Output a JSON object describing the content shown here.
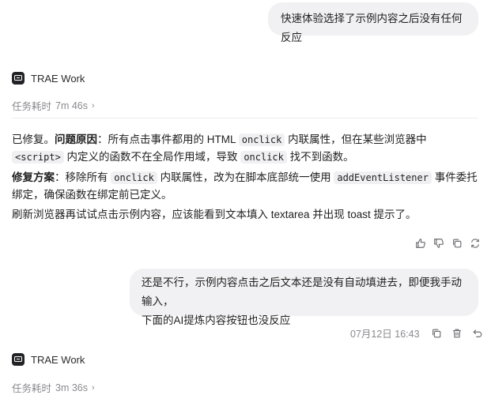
{
  "messages": {
    "user_1": "快速体验选择了示例内容之后没有任何反应",
    "agent_1": {
      "name": "TRAE Work",
      "task_time_label": "任务耗时",
      "task_time_value": "7m 46s",
      "p1": {
        "t1": "已修复。",
        "t2": "问题原因",
        "t3": "：所有点击事件都用的 HTML ",
        "c1": "onclick",
        "t4": " 内联属性，但在某些浏览器中 ",
        "c2": "<script>",
        "t5": " 内定义的函数不在全局作用域，导致 ",
        "c3": "onclick",
        "t6": " 找不到函数。"
      },
      "p2": {
        "t1": "修复方案",
        "t2": "：移除所有 ",
        "c1": "onclick",
        "t3": " 内联属性，改为在脚本底部统一使用 ",
        "c2": "addEventListener",
        "t4": " 事件委托绑定，确保函数在绑定前已定义。"
      },
      "p3": "刷新浏览器再试试点击示例内容，应该能看到文本填入 textarea 并出现 toast 提示了。",
      "actions": [
        "thumbs-up-icon",
        "thumbs-down-icon",
        "copy-icon",
        "retry-icon"
      ]
    },
    "user_2": {
      "line1": "还是不行，示例内容点击之后文本还是没有自动填进去，即便我手动输入，",
      "line2": "下面的AI提炼内容按钮也没反应",
      "time": "07月12日 16:43",
      "actions": [
        "copy-icon",
        "delete-icon",
        "undo-icon"
      ]
    },
    "agent_2": {
      "name": "TRAE Work",
      "task_time_label": "任务耗时",
      "task_time_value": "3m 36s"
    }
  }
}
